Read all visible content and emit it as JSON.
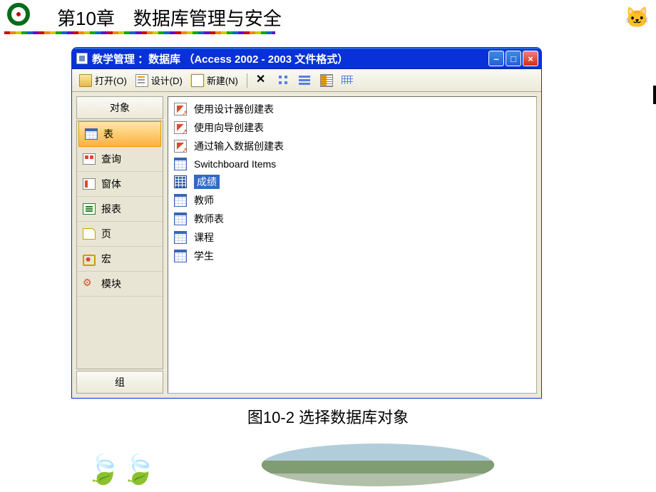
{
  "chapter_title": "第10章　数据库管理与安全",
  "window": {
    "title": "教学管理 ：数据库 （Access 2002 - 2003 文件格式）",
    "toolbar": {
      "open_label": "打开(O)",
      "design_label": "设计(D)",
      "new_label": "新建(N)"
    }
  },
  "sidebar": {
    "header": "对象",
    "footer": "组",
    "items": [
      {
        "label": "表",
        "icon": "table",
        "selected": true
      },
      {
        "label": "查询",
        "icon": "query"
      },
      {
        "label": "窗体",
        "icon": "form"
      },
      {
        "label": "报表",
        "icon": "report"
      },
      {
        "label": "页",
        "icon": "page"
      },
      {
        "label": "宏",
        "icon": "macro"
      },
      {
        "label": "模块",
        "icon": "module"
      }
    ]
  },
  "main": {
    "items": [
      {
        "label": "使用设计器创建表",
        "icon": "wizard"
      },
      {
        "label": "使用向导创建表",
        "icon": "wizard"
      },
      {
        "label": "通过输入数据创建表",
        "icon": "wizard"
      },
      {
        "label": "Switchboard Items",
        "icon": "tbl"
      },
      {
        "label": "成绩",
        "icon": "tbl-sel",
        "selected": true
      },
      {
        "label": "教师",
        "icon": "tbl"
      },
      {
        "label": "教师表",
        "icon": "tbl"
      },
      {
        "label": "课程",
        "icon": "tbl"
      },
      {
        "label": "学生",
        "icon": "tbl"
      }
    ]
  },
  "caption": "图10-2  选择数据库对象"
}
